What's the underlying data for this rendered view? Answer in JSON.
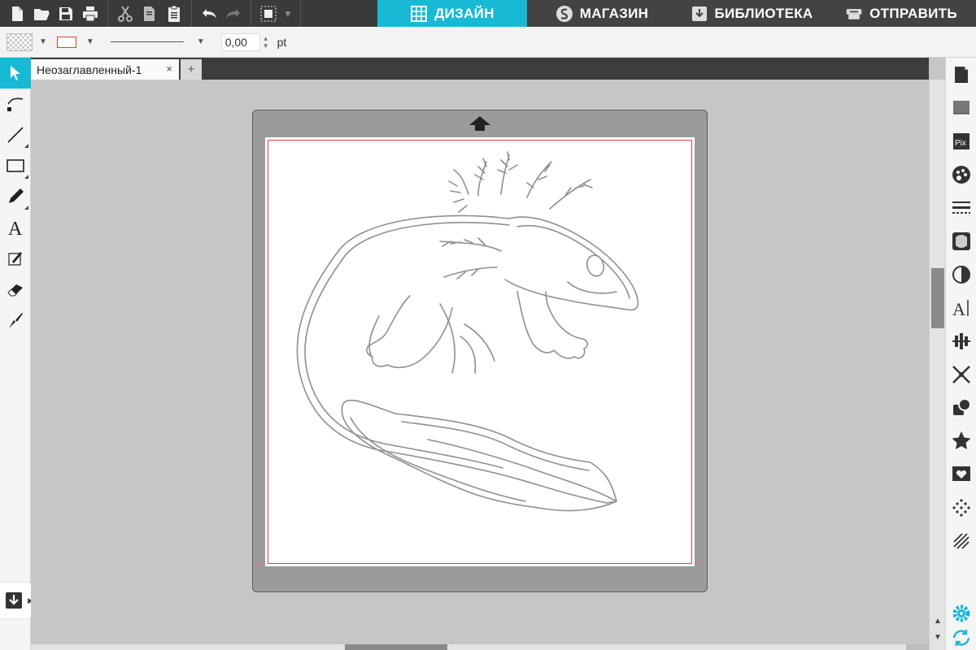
{
  "toolbar": {
    "tabs": [
      {
        "label": "ДИЗАЙН",
        "icon": "grid-icon",
        "active": true
      },
      {
        "label": "МАГАЗИН",
        "icon": "store-icon",
        "active": false
      },
      {
        "label": "БИБЛИОТЕКА",
        "icon": "library-icon",
        "active": false
      },
      {
        "label": "ОТПРАВИТЬ",
        "icon": "send-icon",
        "active": false
      }
    ],
    "icons": [
      "new-file-icon",
      "open-folder-icon",
      "save-icon",
      "print-icon",
      "cut-icon",
      "copy-icon",
      "paste-icon",
      "undo-icon",
      "redo-icon",
      "group-icon"
    ]
  },
  "properties": {
    "line_width": "0,00",
    "unit": "pt",
    "line_color": "#e0402a"
  },
  "document": {
    "tab_title": "Неозаглавленный-1",
    "close_glyph": "×",
    "add_glyph": "+"
  },
  "colors": {
    "accent": "#18b9d5",
    "toolbar_bg": "#3a3a3a",
    "cut_border": "#e04040"
  },
  "tools_left": [
    "select-icon",
    "point-edit-icon",
    "line-icon",
    "rectangle-icon",
    "pencil-icon",
    "text-icon",
    "sketch-icon",
    "eraser-icon",
    "knife-icon"
  ],
  "tools_right": [
    "page-setup-icon",
    "registration-marks-icon",
    "pixscan-icon",
    "fill-color-icon",
    "line-style-icon",
    "trace-icon",
    "contrast-icon",
    "text-style-icon",
    "align-icon",
    "replicate-icon",
    "modify-icon",
    "offset-icon",
    "transform-icon",
    "library-icon",
    "rhinestone-icon",
    "sketch-fill-icon"
  ]
}
